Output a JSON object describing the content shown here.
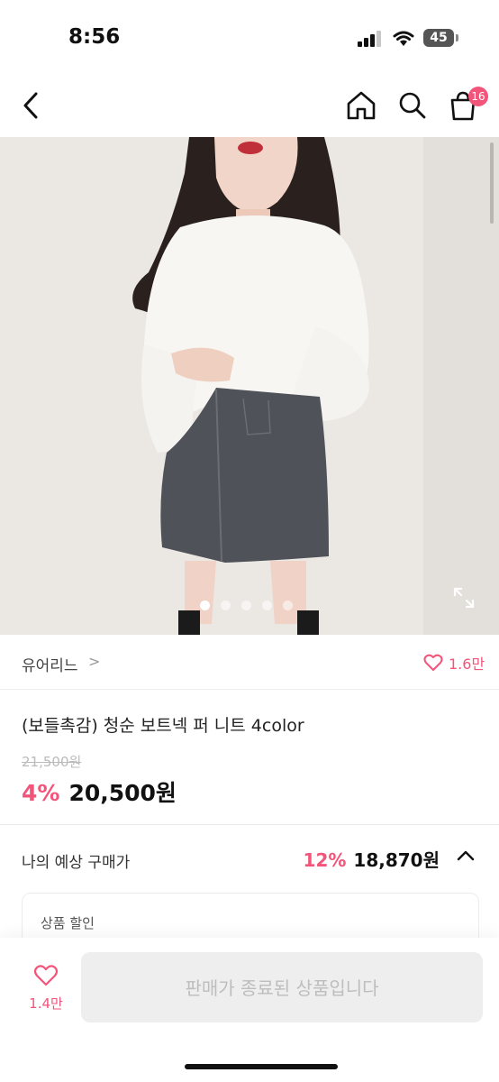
{
  "status_bar": {
    "time": "8:56",
    "battery": "45"
  },
  "header": {
    "cart_badge": "16"
  },
  "gallery": {
    "page_count": 5,
    "active_index": 0
  },
  "shop": {
    "name": "유어리느",
    "chevron": ">",
    "like_count": "1.6만"
  },
  "product": {
    "title": "(보들촉감) 청순 보트넥 퍼 니트 4color",
    "original_price": "21,500원",
    "discount_rate": "4%",
    "price": "20,500원"
  },
  "expected_price": {
    "label": "나의 예상 구매가",
    "discount_rate": "12%",
    "price": "18,870원"
  },
  "discount_box": {
    "label": "상품 할인"
  },
  "bottom_bar": {
    "wish_count": "1.4만",
    "sold_out_label": "판매가 종료된 상품입니다"
  },
  "colors": {
    "accent": "#f2547a",
    "sold_out_bg": "#eeeeee",
    "sold_out_text": "#bdbdbd"
  }
}
